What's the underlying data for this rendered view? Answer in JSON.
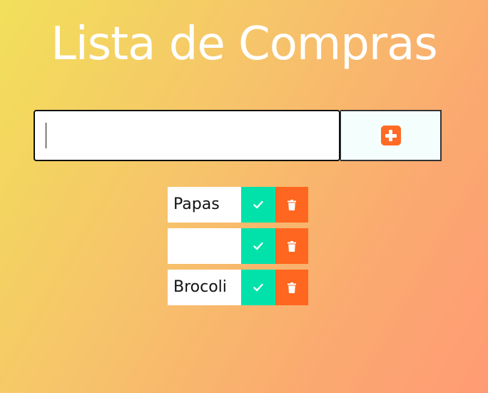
{
  "header": {
    "title": "Lista de Compras"
  },
  "add_form": {
    "input_value": "",
    "input_placeholder": "",
    "add_icon": "plus-square-icon"
  },
  "todos": [
    {
      "text": "Papas",
      "complete_icon": "check-icon",
      "delete_icon": "trash-icon"
    },
    {
      "text": "",
      "complete_icon": "check-icon",
      "delete_icon": "trash-icon"
    },
    {
      "text": "Brocoli",
      "complete_icon": "check-icon",
      "delete_icon": "trash-icon"
    }
  ],
  "colors": {
    "complete": "#00e2aa",
    "delete": "#ff661f",
    "accent": "#ff6a24"
  }
}
